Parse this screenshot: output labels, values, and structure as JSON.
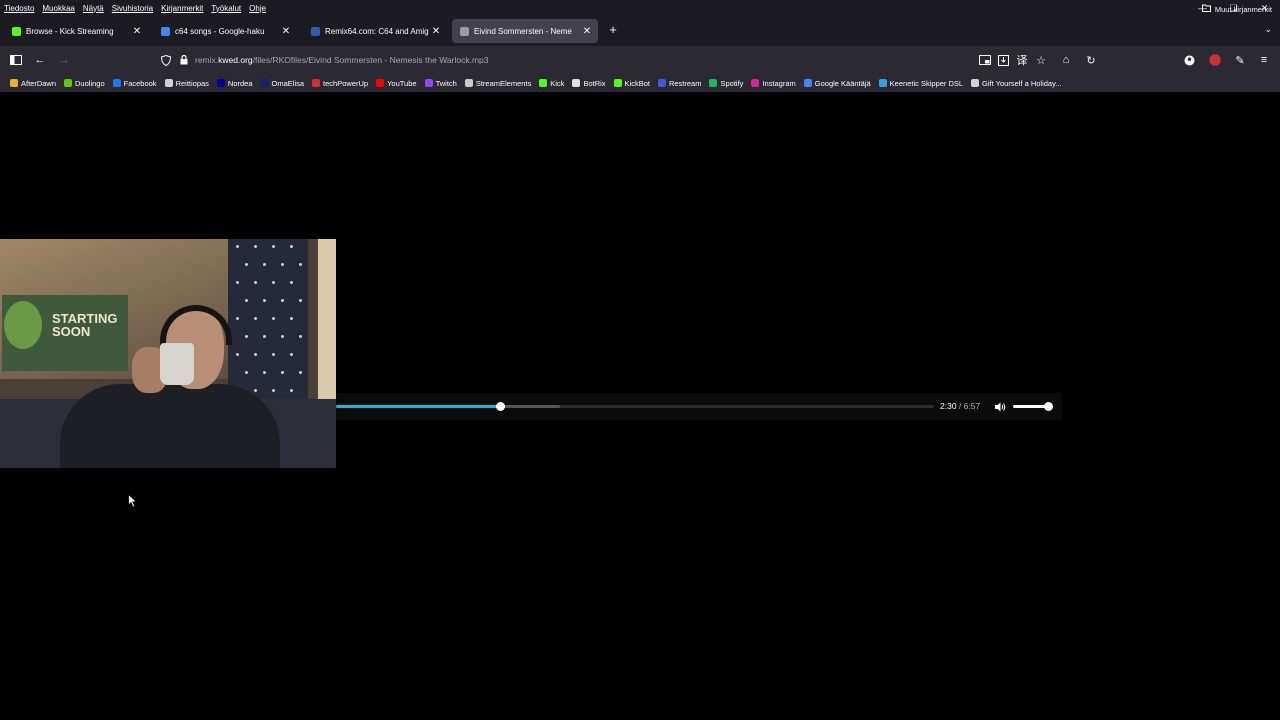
{
  "menubar": {
    "items": [
      "Tiedosto",
      "Muokkaa",
      "Näytä",
      "Sivuhistoria",
      "Kirjanmerkit",
      "Työkalut",
      "Ohje"
    ]
  },
  "tabs": [
    {
      "title": "Browse - Kick Streaming",
      "favicon_color": "#53fc18",
      "active": false
    },
    {
      "title": "c64 songs - Google-haku",
      "favicon_color": "#4285f4",
      "active": false
    },
    {
      "title": "Remix64.com: C64 and Amiga M",
      "favicon_color": "#2c5fb3",
      "active": false
    },
    {
      "title": "Eivind Sommersten - Neme",
      "favicon_color": "#9b9ba1",
      "active": true
    }
  ],
  "url": {
    "prefix": "remix.",
    "host": "kwed.org",
    "path": "/files/RKOfiles/Eivind Sommersten - Nemesis the Warlock.mp3"
  },
  "bookmarks": [
    {
      "label": "AfterDawn",
      "color": "#e8b02b"
    },
    {
      "label": "Duolingo",
      "color": "#58cc02"
    },
    {
      "label": "Facebook",
      "color": "#1877f2"
    },
    {
      "label": "Reittiopas",
      "color": "#cfcfd4"
    },
    {
      "label": "Nordea",
      "color": "#0000a0"
    },
    {
      "label": "OmaElisa",
      "color": "#1d1d6b"
    },
    {
      "label": "techPowerUp",
      "color": "#d62d2d"
    },
    {
      "label": "YouTube",
      "color": "#ff0000"
    },
    {
      "label": "Twitch",
      "color": "#9146ff"
    },
    {
      "label": "StreamElements",
      "color": "#c9c9c9"
    },
    {
      "label": "Kick",
      "color": "#53fc18"
    },
    {
      "label": "BotRix",
      "color": "#e0e0e0"
    },
    {
      "label": "KickBot",
      "color": "#53fc18"
    },
    {
      "label": "Restream",
      "color": "#3b5bdb"
    },
    {
      "label": "Spotify",
      "color": "#1db954"
    },
    {
      "label": "Instagram",
      "color": "#d6249f"
    },
    {
      "label": "Google Kääntäjä",
      "color": "#4285f4"
    },
    {
      "label": "Keenetic Skipper DSL",
      "color": "#29a3e0"
    },
    {
      "label": "Gift Yourself a Holiday...",
      "color": "#cfcfd4"
    }
  ],
  "other_bookmarks": "Muut kirjanmerkit",
  "webcam": {
    "poster_text": "STARTING\nSOON"
  },
  "player": {
    "current_time": "2:30",
    "separator": " / ",
    "duration": "6:57",
    "progress_fraction": 0.2746,
    "buffered_fraction": 0.3744,
    "volume_fraction": 1.0,
    "accent_color": "#1eb5d6"
  }
}
